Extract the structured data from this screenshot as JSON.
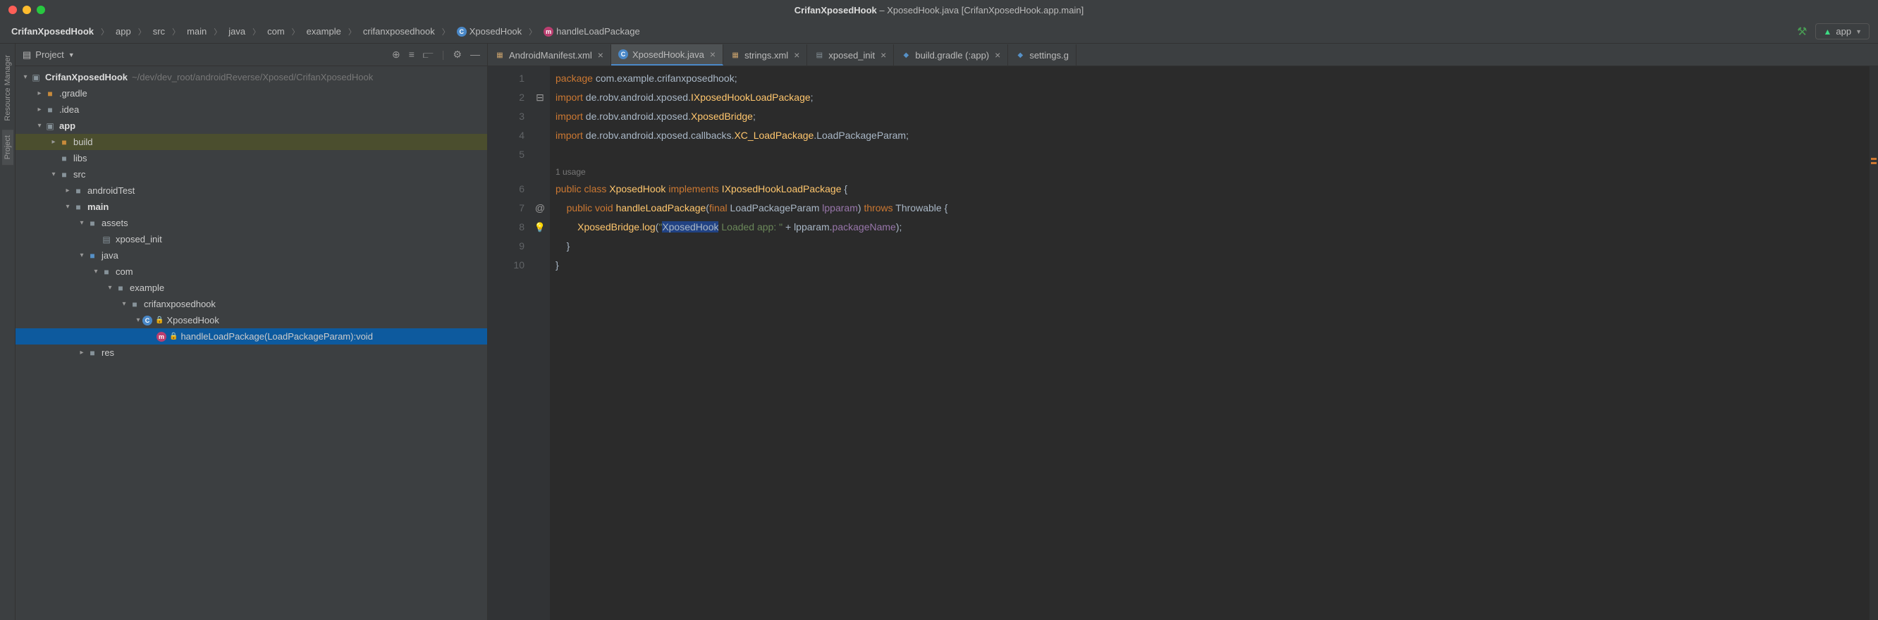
{
  "window": {
    "title_project": "CrifanXposedHook",
    "title_file": "XposedHook.java",
    "title_module": "[CrifanXposedHook.app.main]"
  },
  "breadcrumb": {
    "items": [
      "CrifanXposedHook",
      "app",
      "src",
      "main",
      "java",
      "com",
      "example",
      "crifanxposedhook",
      "XposedHook",
      "handleLoadPackage"
    ]
  },
  "run_config": {
    "label": "app"
  },
  "panel": {
    "title": "Project"
  },
  "left_gutter": {
    "item1": "Resource Manager",
    "item2": "Project"
  },
  "tree": {
    "root_name": "CrifanXposedHook",
    "root_path": "~/dev/dev_root/androidReverse/Xposed/CrifanXposedHook",
    "gradle": ".gradle",
    "idea": ".idea",
    "app": "app",
    "build": "build",
    "libs": "libs",
    "src": "src",
    "androidTest": "androidTest",
    "main": "main",
    "assets": "assets",
    "xposed_init": "xposed_init",
    "java": "java",
    "com": "com",
    "example": "example",
    "pkg": "crifanxposedhook",
    "class": "XposedHook",
    "method": "handleLoadPackage(LoadPackageParam):void",
    "res": "res"
  },
  "tabs": [
    {
      "label": "AndroidManifest.xml",
      "type": "xml"
    },
    {
      "label": "XposedHook.java",
      "type": "class",
      "active": true
    },
    {
      "label": "strings.xml",
      "type": "xml"
    },
    {
      "label": "xposed_init",
      "type": "file"
    },
    {
      "label": "build.gradle (:app)",
      "type": "gradle"
    },
    {
      "label": "settings.g",
      "type": "gradle"
    }
  ],
  "code": {
    "line_numbers": [
      "1",
      "2",
      "3",
      "4",
      "5",
      "",
      "6",
      "7",
      "8",
      "9",
      "10"
    ],
    "gutter_marks": {
      "7": "@",
      "8": "bulb"
    },
    "usage_hint": "1 usage",
    "l1": {
      "kw": "package",
      "pkg": " com.example.crifanxposedhook;"
    },
    "l2": {
      "kw": "import",
      "p": " de.robv.android.xposed.",
      "cls": "IXposedHookLoadPackage",
      "s": ";"
    },
    "l3": {
      "kw": "import",
      "p": " de.robv.android.xposed.",
      "cls": "XposedBridge",
      "s": ";"
    },
    "l4": {
      "kw": "import",
      "p": " de.robv.android.xposed.callbacks.",
      "cls": "XC_LoadPackage",
      "p2": ".LoadPackageParam;"
    },
    "l6": {
      "kw1": "public class",
      "cls": " XposedHook ",
      "kw2": "implements",
      "iface": " IXposedHookLoadPackage ",
      "b": "{"
    },
    "l7": {
      "indent": "    ",
      "kw1": "public void",
      "m": " handleLoadPackage",
      "p1": "(",
      "kw2": "final",
      "t": " LoadPackageParam ",
      "arg": "lpparam",
      "p2": ") ",
      "kw3": "throws",
      "ex": " Throwable ",
      "b": "{"
    },
    "l8": {
      "indent": "        ",
      "obj": "XposedBridge",
      "dot": ".",
      "call": "log",
      "p1": "(",
      "q": "\"",
      "sel": "XposedHook",
      "str": " Loaded app: ",
      "q2": "\"",
      "plus": " + lpparam.",
      "field": "packageName",
      "p2": ");"
    },
    "l9": {
      "indent": "    ",
      "b": "}"
    },
    "l10": {
      "b": "}"
    }
  }
}
